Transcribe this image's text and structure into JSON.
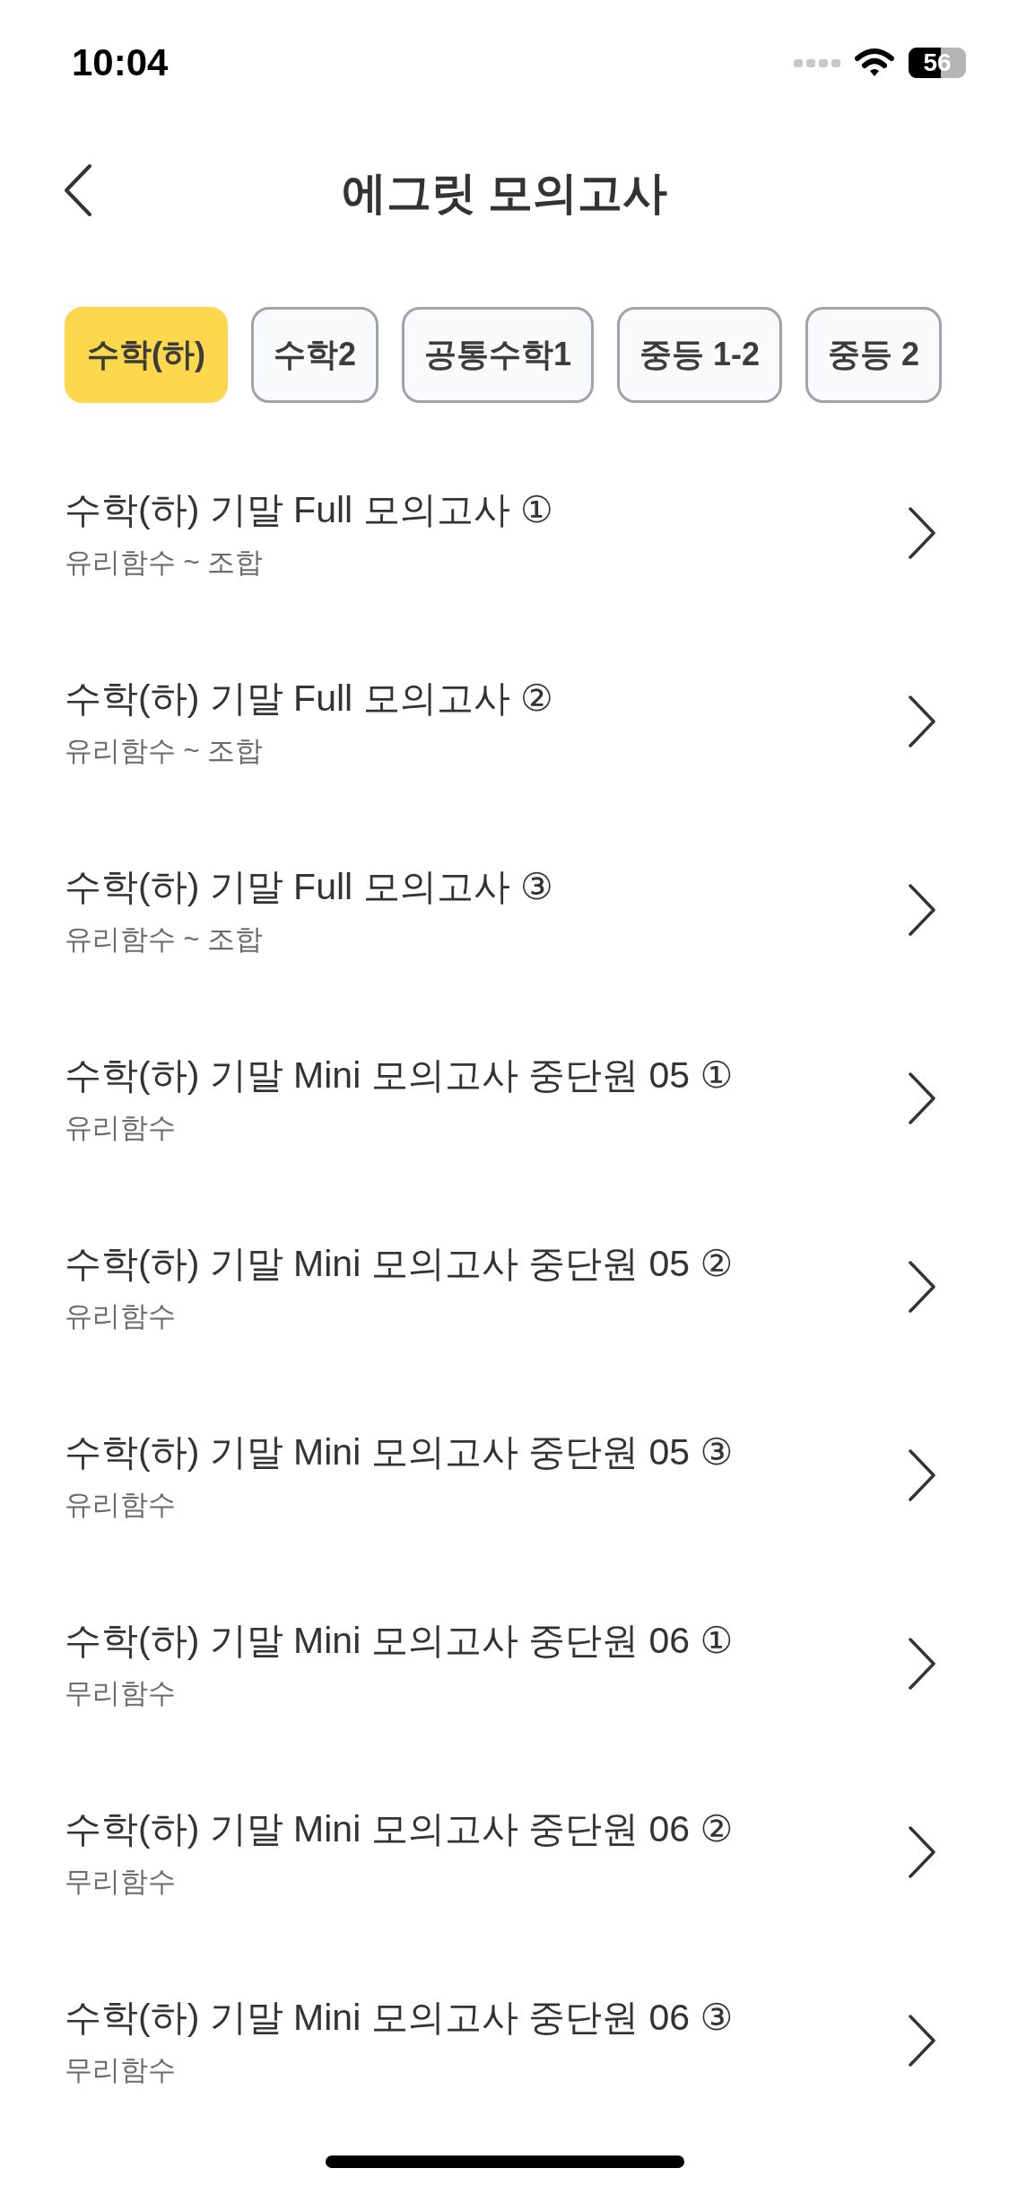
{
  "status_bar": {
    "time": "10:04",
    "battery": "56"
  },
  "header": {
    "title": "에그릿 모의고사"
  },
  "tabs": [
    {
      "label": "수학(하)",
      "selected": true
    },
    {
      "label": "수학2",
      "selected": false
    },
    {
      "label": "공통수학1",
      "selected": false
    },
    {
      "label": "중등 1-2",
      "selected": false
    },
    {
      "label": "중등 2",
      "selected": false
    }
  ],
  "items": [
    {
      "title": "수학(하) 기말 Full 모의고사 ①",
      "subtitle": "유리함수 ~ 조합"
    },
    {
      "title": "수학(하) 기말 Full 모의고사 ②",
      "subtitle": "유리함수 ~ 조합"
    },
    {
      "title": "수학(하) 기말 Full 모의고사 ③",
      "subtitle": "유리함수 ~ 조합"
    },
    {
      "title": "수학(하) 기말 Mini 모의고사 중단원 05 ①",
      "subtitle": "유리함수"
    },
    {
      "title": "수학(하) 기말 Mini 모의고사 중단원 05 ②",
      "subtitle": "유리함수"
    },
    {
      "title": "수학(하) 기말 Mini 모의고사 중단원 05 ③",
      "subtitle": "유리함수"
    },
    {
      "title": "수학(하) 기말 Mini 모의고사 중단원 06 ①",
      "subtitle": "무리함수"
    },
    {
      "title": "수학(하) 기말 Mini 모의고사 중단원 06 ②",
      "subtitle": "무리함수"
    },
    {
      "title": "수학(하) 기말 Mini 모의고사 중단원 06 ③",
      "subtitle": "무리함수"
    }
  ]
}
